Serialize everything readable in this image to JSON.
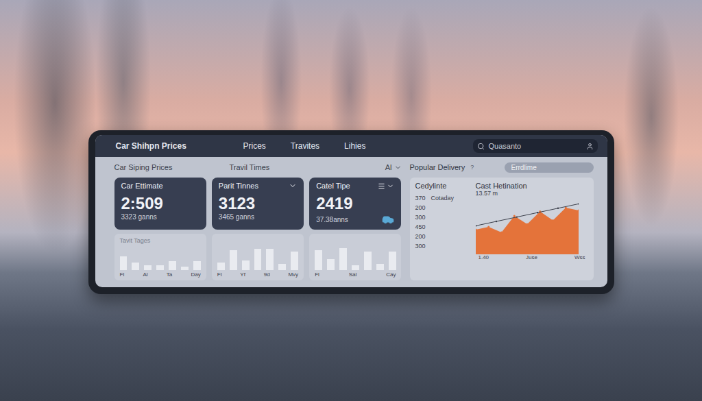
{
  "header": {
    "title": "Car Shihpn Prices",
    "nav": [
      "Prices",
      "Travites",
      "Lihies"
    ],
    "search": {
      "placeholder": "Quasanto"
    }
  },
  "section_titles": [
    "Car Siping Prices",
    "Travil Times"
  ],
  "filter": {
    "label": "Al"
  },
  "popular": {
    "label": "Popular Delivery",
    "hint": "?",
    "pill": "Errdlime"
  },
  "stat_cards": [
    {
      "title": "Car Ettimate",
      "value": "2:509",
      "sub": "3323 ganns",
      "kind": "plain"
    },
    {
      "title": "Parit Tinnes",
      "value": "3123",
      "sub": "3465 ganns",
      "kind": "dropdown"
    },
    {
      "title": "Catel Tipe",
      "value": "2419",
      "sub": "37.38anns",
      "kind": "car"
    }
  ],
  "bar_cards": [
    {
      "title": "Tavit Tages",
      "values": [
        55,
        30,
        20,
        20,
        35,
        15,
        35
      ],
      "labels": [
        "Fl",
        "Al",
        "Ta",
        "Day"
      ]
    },
    {
      "values": [
        30,
        80,
        40,
        85,
        85,
        25,
        75
      ],
      "labels": [
        "Fl",
        "Yf",
        "9d",
        "Mvy"
      ]
    },
    {
      "values": [
        80,
        45,
        90,
        20,
        75,
        25,
        75
      ],
      "labels": [
        "Fl",
        "Sal",
        "Cay"
      ]
    }
  ],
  "trend": {
    "title": "Cedylinte",
    "tick_note": "Cotaday",
    "y_ticks": [
      "370",
      "200",
      "300",
      "450",
      "200",
      "300"
    ],
    "chart_title": "Cast Hetination",
    "chart_value": "13.57 m",
    "x_ticks": [
      "1.40",
      "Juse",
      "Wss"
    ],
    "area": [
      45,
      50,
      40,
      70,
      55,
      78,
      62,
      85,
      80
    ],
    "line": [
      52,
      60,
      68,
      76,
      84,
      92
    ]
  }
}
